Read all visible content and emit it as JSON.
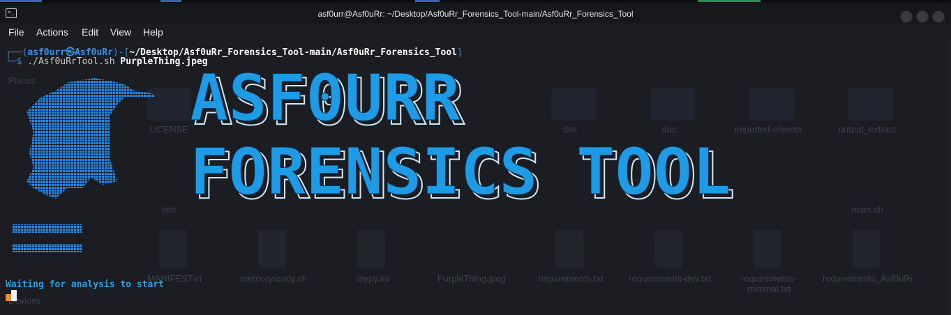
{
  "window": {
    "title": "asf0urr@Asf0uRr: ~/Desktop/Asf0uRr_Forensics_Tool-main/Asf0uRr_Forensics_Tool",
    "icon": "terminal-icon"
  },
  "menu": [
    "File",
    "Actions",
    "Edit",
    "View",
    "Help"
  ],
  "terminal": {
    "prompt_box_open": "┌──(",
    "prompt_user": "asf0urr㉿Asf0uRr",
    "prompt_mid": ")-[",
    "prompt_path": "~/Desktop/Asf0uRr_Forensics_Tool-main/Asf0uRr_Forensics_Tool",
    "prompt_close": "]",
    "prompt_line2": "└─$ ",
    "command": "./Asf0uRrTool.sh",
    "argument": "PurpleThing.jpeg",
    "banner_line1": "ASF0URR",
    "banner_line2": "FORENSICS TOOL",
    "status": "Waiting for analysis to start"
  },
  "background_filemanager": {
    "sidebar": [
      "Places",
      "Devices"
    ],
    "files": [
      "LICENSE",
      "dist",
      "doc",
      "imported-objects",
      "output_extract",
      "test",
      "main.sh",
      "MANIFEST.in",
      "memoryready.sh",
      "mypy.ini",
      "PurpleThing.jpeg",
      "requirements.txt",
      "requirements-dev.txt",
      "requirements-minimal.txt",
      "requirements_Asf0uRr"
    ]
  },
  "colors": {
    "terminal_bg": "#1b1d22",
    "prompt_blue": "#3f88d6",
    "banner_blue": "#1f9be6",
    "status_blue": "#2d9fe0",
    "cursor_orange": "#f08a2a"
  }
}
